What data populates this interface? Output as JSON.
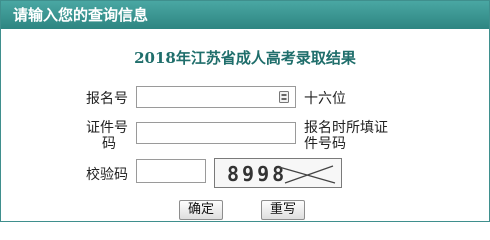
{
  "header": {
    "title": "请输入您的查询信息"
  },
  "heading": "2018年江苏省成人高考录取结果",
  "form": {
    "exam_number": {
      "label": "报名号",
      "value": "",
      "hint": "十六位"
    },
    "id_number": {
      "label_line1": "证件号",
      "label_line2": "码",
      "value": "",
      "hint_line1": "报名时所填证",
      "hint_line2": "件号码"
    },
    "captcha": {
      "label": "校验码",
      "value": "",
      "code": "8998"
    }
  },
  "buttons": {
    "confirm": "确定",
    "reset": "重写"
  },
  "colors": {
    "header_bg": "#3a9793",
    "title_text": "#1f6e6b",
    "border": "#3f8f8d"
  }
}
